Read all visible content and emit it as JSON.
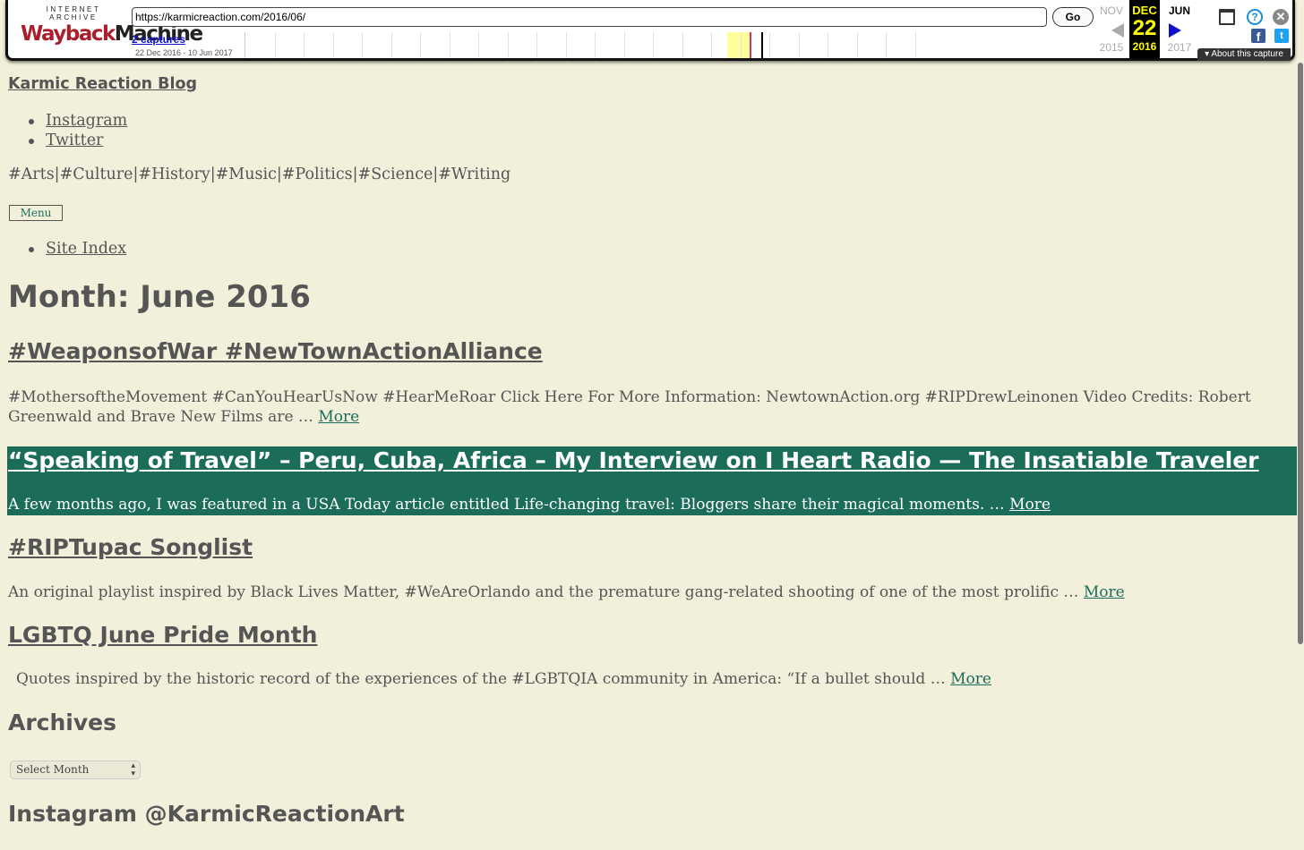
{
  "wayback": {
    "logo_top": "INTERNET ARCHIVE",
    "logo_word1": "Wayback",
    "logo_word2": "Machine",
    "url": "https://karmicreaction.com/2016/06/",
    "go_label": "Go",
    "captures_label": "2 captures",
    "date_range": "22 Dec 2016 - 10 Jun 2017",
    "prev_month": "NOV",
    "prev_year": "2015",
    "cur_month": "DEC",
    "cur_day": "22",
    "cur_year": "2016",
    "next_month": "JUN",
    "next_year": "2017",
    "about_label": "About this capture",
    "colors": {
      "highlight": "#ffff99",
      "capture": "#cc3377",
      "current": "#000000"
    }
  },
  "site": {
    "title": "Karmic Reaction Blog",
    "social": [
      "Instagram",
      "Twitter"
    ],
    "description": "#Arts|#Culture|#History|#Music|#Politics|#Science|#Writing",
    "menu_label": "Menu",
    "nav": [
      "Site Index"
    ],
    "accent_color": "#1b6d5a",
    "background_color": "#f2f0da"
  },
  "main": {
    "page_title": "Month: June 2016",
    "more_label": "More",
    "posts": [
      {
        "title": "#WeaponsofWar #NewTownActionAlliance",
        "excerpt": "#MothersoftheMovement #CanYouHearUsNow #HearMeRoar  Click Here For More Information: NewtownAction.org #RIPDrewLeinonen   Video Credits: Robert Greenwald and Brave New Films are … "
      },
      {
        "title": "“Speaking of Travel” – Peru, Cuba, Africa – My Interview on I Heart Radio — The Insatiable Traveler",
        "excerpt": "A few months ago, I was featured in a USA Today article entitled Life-changing travel: Bloggers share their magical moments. … "
      },
      {
        "title": "#RIPTupac Songlist",
        "excerpt": "An original playlist inspired by Black Lives Matter, #WeAreOrlando and the premature gang-related shooting of one of the most prolific … "
      },
      {
        "title": "LGBTQ June Pride Month ",
        "excerpt": "Quotes inspired by the historic record of the experiences of the #LGBTQIA community in America: “If a bullet should … "
      }
    ]
  },
  "sidebar": {
    "archives_title": "Archives",
    "archives_select": "Select Month",
    "instagram_title": "Instagram @KarmicReactionArt"
  }
}
